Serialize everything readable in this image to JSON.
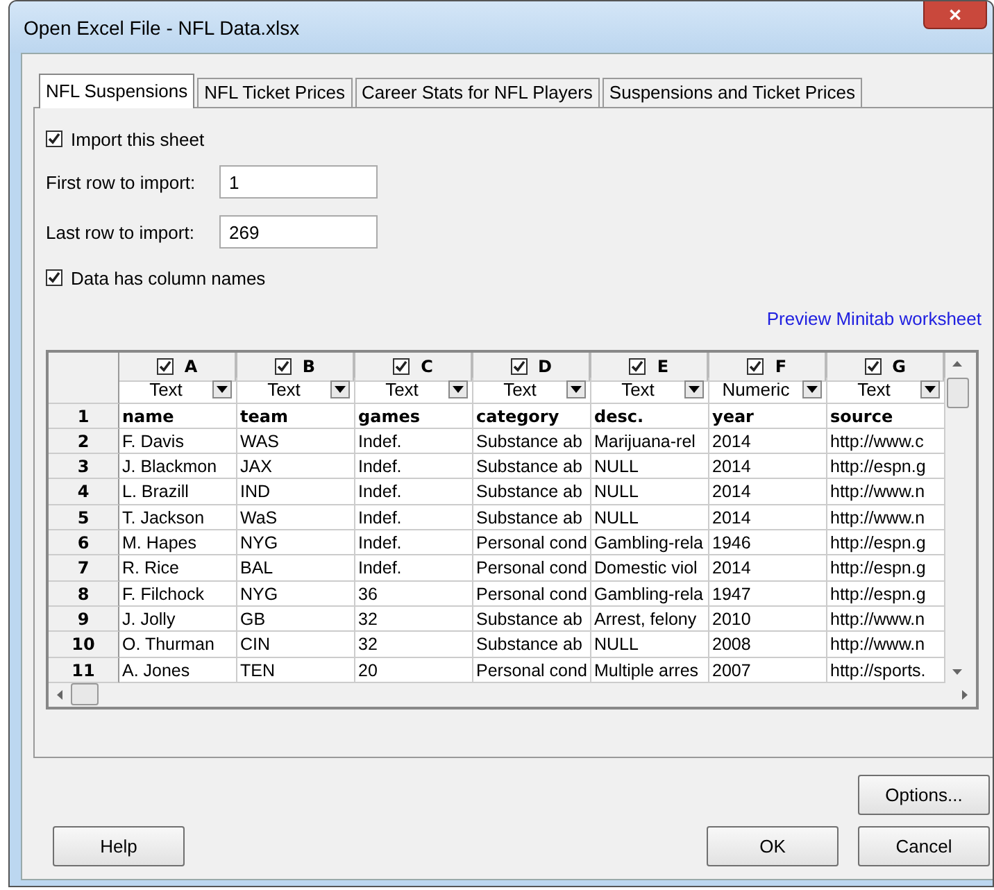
{
  "window": {
    "title": "Open Excel File - NFL Data.xlsx",
    "close": "✕"
  },
  "tabs": [
    {
      "label": "NFL Suspensions",
      "selected": true
    },
    {
      "label": "NFL Ticket Prices",
      "selected": false
    },
    {
      "label": "Career Stats for NFL Players",
      "selected": false
    },
    {
      "label": "Suspensions and Ticket Prices",
      "selected": false
    }
  ],
  "import_sheet": {
    "label": "Import this sheet",
    "checked": true
  },
  "first_row": {
    "label": "First row to import:",
    "value": "1"
  },
  "last_row": {
    "label": "Last row to import:",
    "value": "269"
  },
  "column_names": {
    "label": "Data has column names",
    "checked": true
  },
  "preview_link": "Preview Minitab worksheet",
  "grid": {
    "columns": [
      {
        "letter": "A",
        "checked": true,
        "type": "Text"
      },
      {
        "letter": "B",
        "checked": true,
        "type": "Text"
      },
      {
        "letter": "C",
        "checked": true,
        "type": "Text"
      },
      {
        "letter": "D",
        "checked": true,
        "type": "Text"
      },
      {
        "letter": "E",
        "checked": true,
        "type": "Text"
      },
      {
        "letter": "F",
        "checked": true,
        "type": "Numeric"
      },
      {
        "letter": "G",
        "checked": true,
        "type": "Text"
      }
    ],
    "rows": [
      {
        "kind": "names",
        "number": "1",
        "cells": [
          "name",
          "team",
          "games",
          "category",
          "desc.",
          "year",
          "source"
        ]
      },
      {
        "kind": "data",
        "number": "2",
        "cells": [
          "F. Davis",
          "WAS",
          "Indef.",
          "Substance ab",
          "Marijuana-rel",
          "2014",
          "http://www.c"
        ]
      },
      {
        "kind": "data",
        "number": "3",
        "cells": [
          "J. Blackmon",
          "JAX",
          "Indef.",
          "Substance ab",
          "NULL",
          "2014",
          "http://espn.g"
        ]
      },
      {
        "kind": "data",
        "number": "4",
        "cells": [
          "L. Brazill",
          "IND",
          "Indef.",
          "Substance ab",
          "NULL",
          "2014",
          "http://www.n"
        ]
      },
      {
        "kind": "data",
        "number": "5",
        "cells": [
          "T. Jackson",
          "WaS",
          "Indef.",
          "Substance ab",
          "NULL",
          "2014",
          "http://www.n"
        ]
      },
      {
        "kind": "data",
        "number": "6",
        "cells": [
          "M. Hapes",
          "NYG",
          "Indef.",
          "Personal cond",
          "Gambling-rela",
          "1946",
          "http://espn.g"
        ]
      },
      {
        "kind": "data",
        "number": "7",
        "cells": [
          "R. Rice",
          "BAL",
          "Indef.",
          "Personal cond",
          "Domestic viol",
          "2014",
          "http://espn.g"
        ]
      },
      {
        "kind": "data",
        "number": "8",
        "cells": [
          "F. Filchock",
          "NYG",
          "36",
          "Personal cond",
          "Gambling-rela",
          "1947",
          "http://espn.g"
        ]
      },
      {
        "kind": "data",
        "number": "9",
        "cells": [
          "J. Jolly",
          "GB",
          "32",
          "Substance ab",
          "Arrest, felony",
          "2010",
          "http://www.n"
        ]
      },
      {
        "kind": "data",
        "number": "10",
        "cells": [
          "O. Thurman",
          "CIN",
          "32",
          "Substance ab",
          "NULL",
          "2008",
          "http://www.n"
        ]
      },
      {
        "kind": "data",
        "number": "11",
        "cells": [
          "A. Jones",
          "TEN",
          "20",
          "Personal cond",
          "Multiple arres",
          "2007",
          "http://sports."
        ]
      }
    ]
  },
  "buttons": {
    "options": "Options...",
    "help": "Help",
    "ok": "OK",
    "cancel": "Cancel"
  }
}
